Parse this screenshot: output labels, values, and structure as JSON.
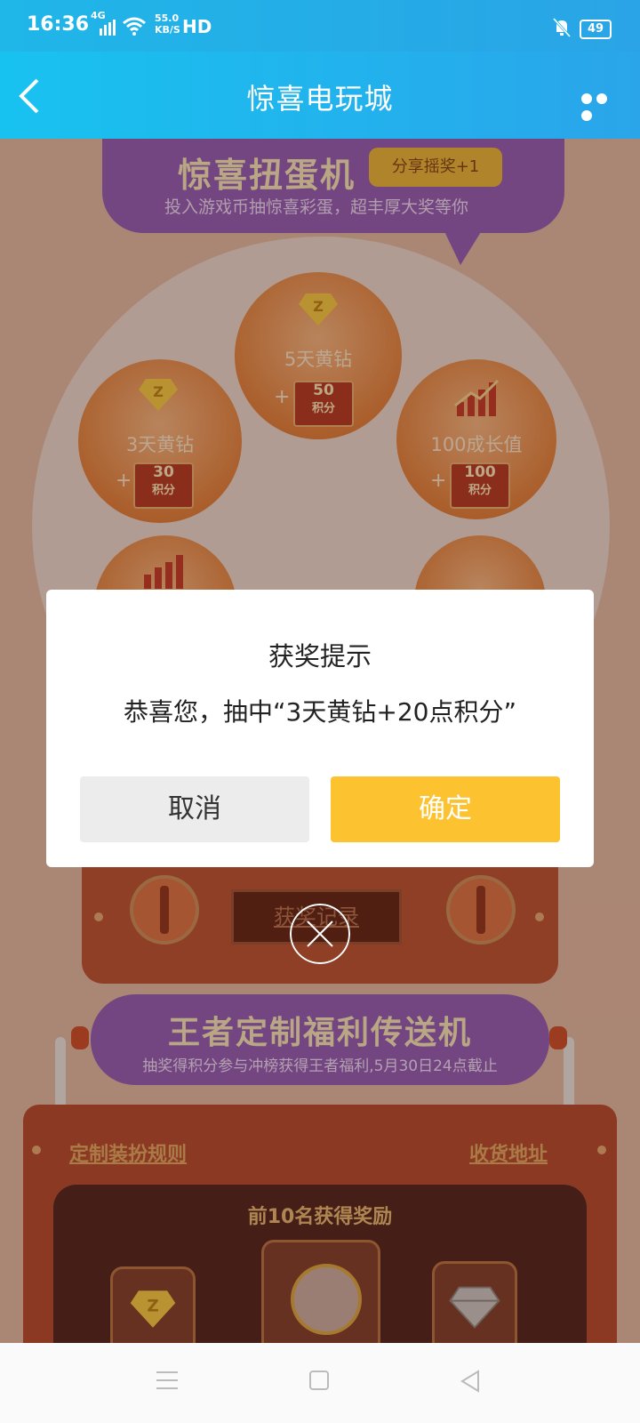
{
  "status_bar": {
    "time": "16:36",
    "network": "4G",
    "speed_value": "55.0",
    "speed_unit": "KB/S",
    "hd": "HD",
    "battery": "49"
  },
  "nav": {
    "title": "惊喜电玩城"
  },
  "gacha": {
    "title": "惊喜扭蛋机",
    "share_label": "分享摇奖+1",
    "subtitle": "投入游戏币抽惊喜彩蛋，超丰厚大奖等你",
    "prizes": [
      {
        "label": "5天黄钻",
        "plus": "+",
        "points": "50",
        "points_unit": "积分",
        "icon": "yellow-diamond-icon"
      },
      {
        "label": "3天黄钻",
        "plus": "+",
        "points": "30",
        "points_unit": "积分",
        "icon": "yellow-diamond-icon"
      },
      {
        "label": "100成长值",
        "plus": "+",
        "points": "100",
        "points_unit": "积分",
        "icon": "growth-chart-icon"
      }
    ],
    "record_button": "获奖记录"
  },
  "transfer": {
    "title": "王者定制福利传送机",
    "subtitle": "抽奖得积分参与冲榜获得王者福利,5月30日24点截止",
    "rules_link": "定制装扮规则",
    "address_link": "收货地址",
    "top_title": "前10名获得奖励"
  },
  "dialog": {
    "title": "获奖提示",
    "message": "恭喜您，抽中“3天黄钻+20点积分”",
    "cancel": "取消",
    "confirm": "确定"
  },
  "colors": {
    "nav_blue": "#1fb6e8",
    "confirm_yellow": "#fdc22f",
    "banner_purple": "#8e55b0"
  }
}
